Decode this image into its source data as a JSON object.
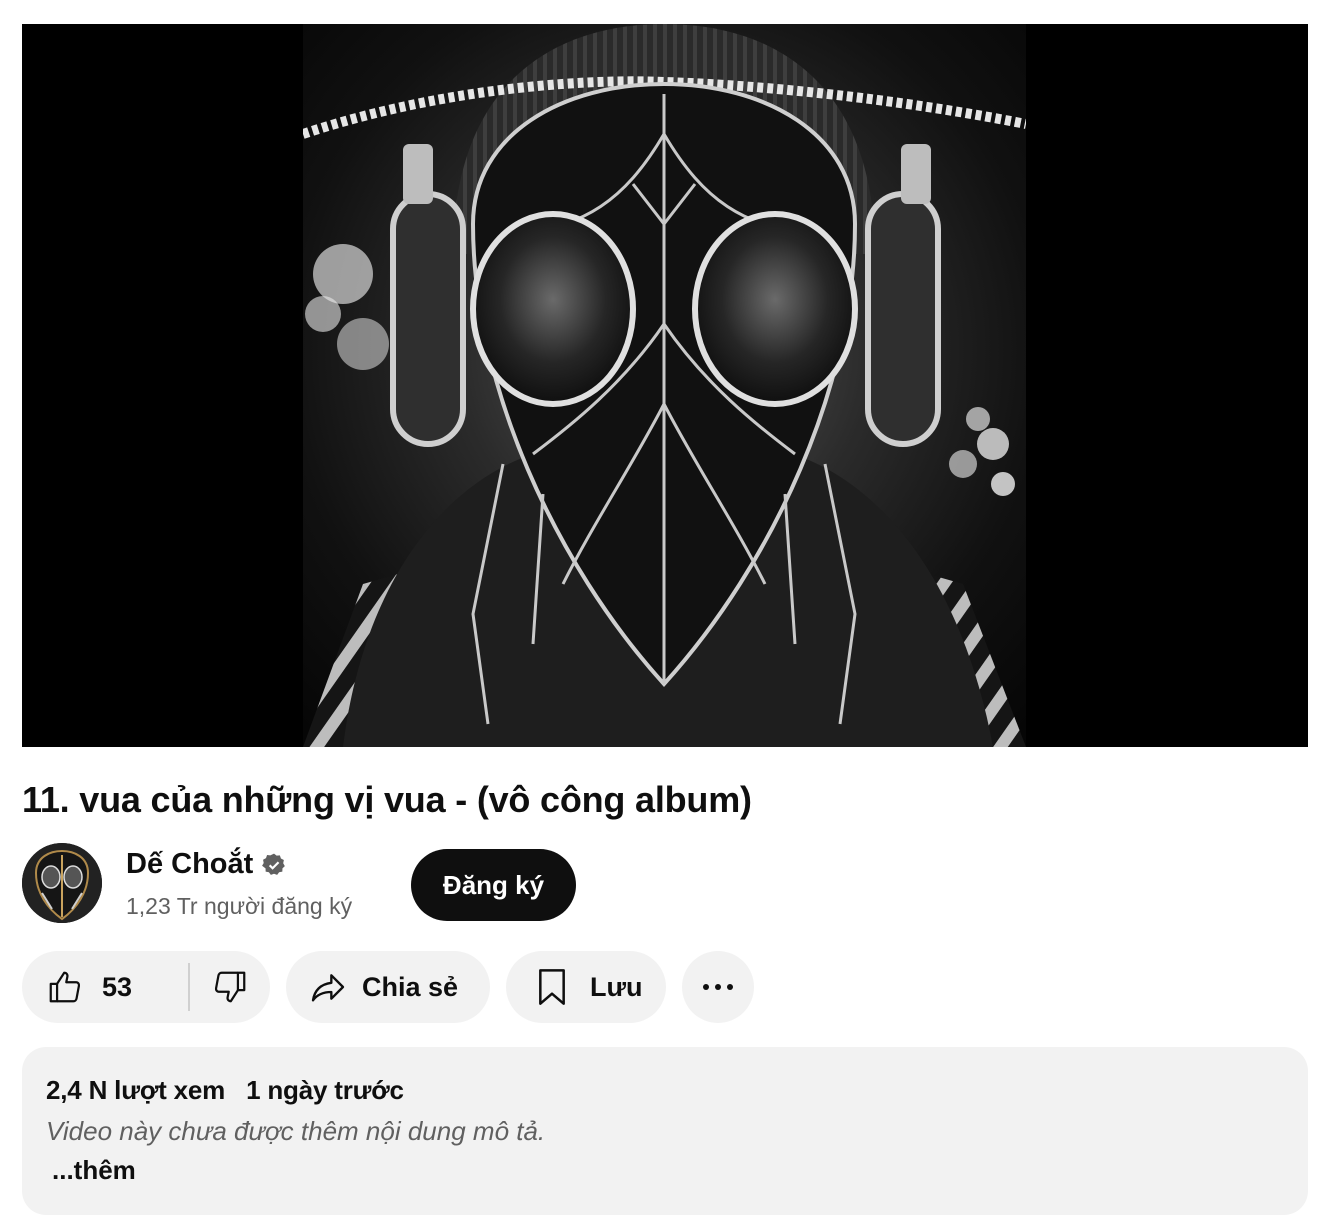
{
  "video": {
    "title": "11. vua của những vị vua - (vô công album)"
  },
  "channel": {
    "name": "Dế Choắt",
    "subscribers": "1,23 Tr người đăng ký",
    "subscribe_label": "Đăng ký",
    "verified_icon": "verified-badge-icon"
  },
  "actions": {
    "like_count": "53",
    "share_label": "Chia sẻ",
    "save_label": "Lưu",
    "icons": [
      "thumbs-up-icon",
      "thumbs-down-icon",
      "share-arrow-icon",
      "bookmark-icon",
      "more-dots-icon"
    ]
  },
  "description": {
    "views": "2,4 N lượt xem",
    "age": "1 ngày trước",
    "text": "Video này chưa được thêm nội dung mô tả.",
    "more_label": "...thêm"
  },
  "colors": {
    "subscribe_bg": "#0f0f0f",
    "pill_bg": "#f2f2f2",
    "secondary_text": "#606060"
  }
}
